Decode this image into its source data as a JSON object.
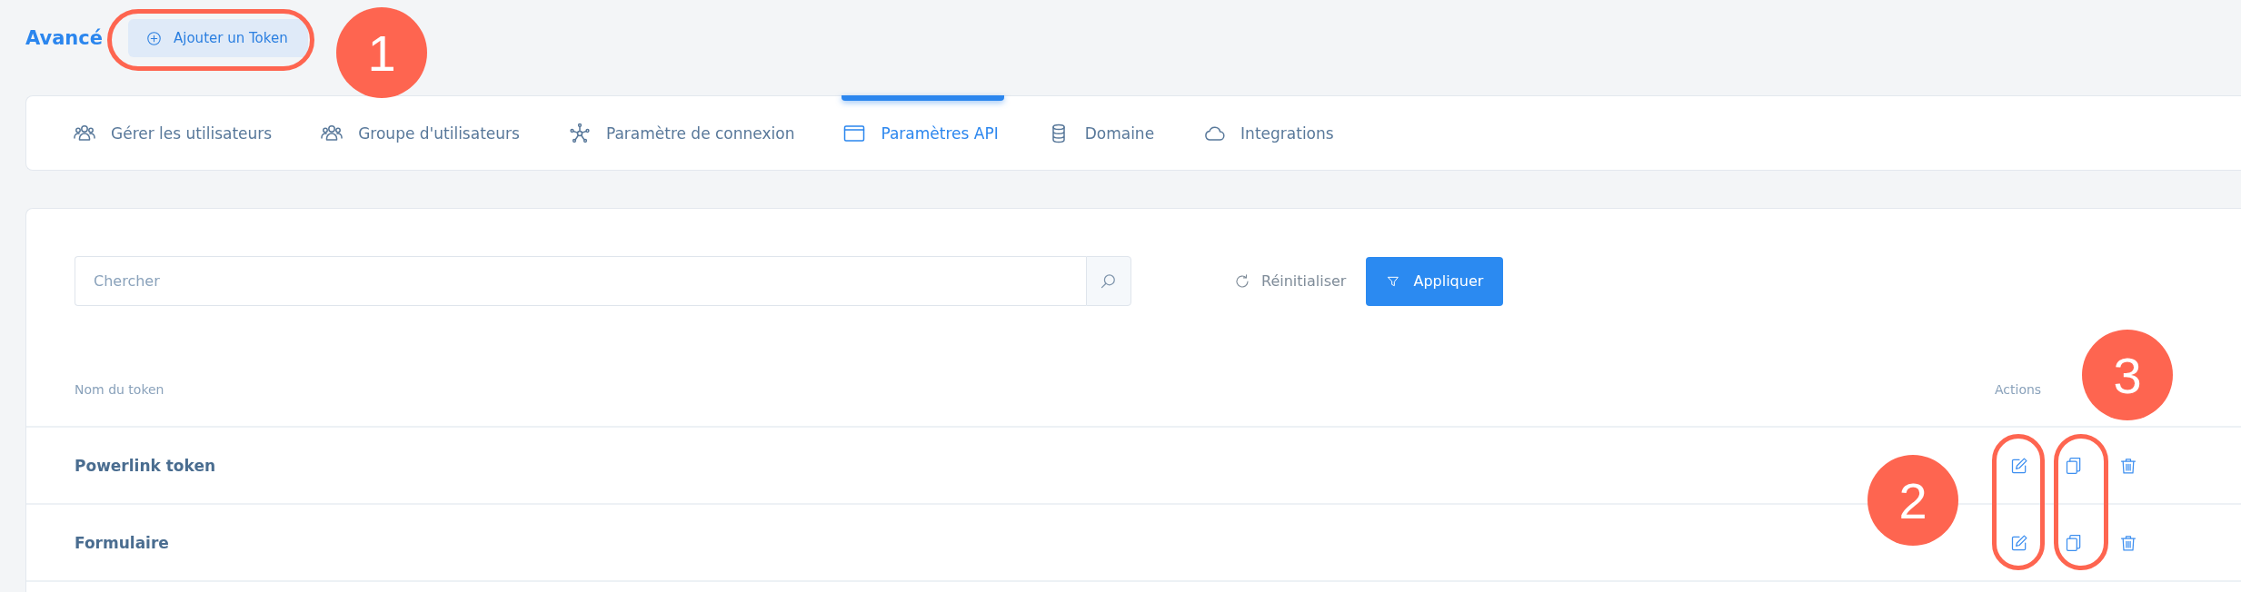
{
  "header": {
    "title": "Avancé",
    "add_button": "Ajouter un Token"
  },
  "tabs": [
    {
      "label": "Gérer les utilisateurs",
      "selected": false
    },
    {
      "label": "Groupe d'utilisateurs",
      "selected": false
    },
    {
      "label": "Paramètre de connexion",
      "selected": false
    },
    {
      "label": "Paramètres API",
      "selected": true
    },
    {
      "label": "Domaine",
      "selected": false
    },
    {
      "label": "Integrations",
      "selected": false
    }
  ],
  "filters": {
    "search": {
      "placeholder": "Chercher"
    },
    "reset": "Réinitialiser",
    "apply": "Appliquer"
  },
  "table": {
    "columns": [
      "Nom du token",
      "Actions"
    ],
    "rows": [
      {
        "name": "Powerlink token"
      },
      {
        "name": "Formulaire"
      }
    ]
  },
  "annotations": [
    {
      "label": "1"
    },
    {
      "label": "2"
    },
    {
      "label": "3"
    }
  ]
}
